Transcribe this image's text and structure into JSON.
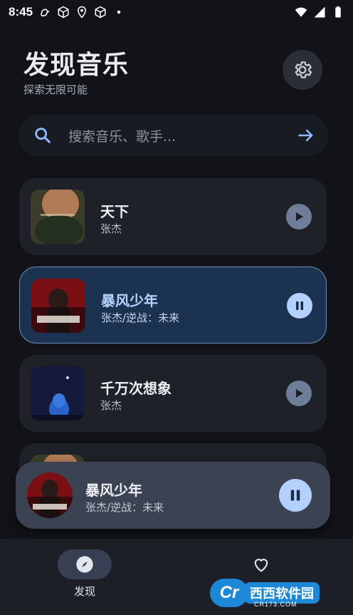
{
  "status_bar": {
    "time": "8:45"
  },
  "header": {
    "title": "发现音乐",
    "subtitle": "探索无限可能"
  },
  "search": {
    "placeholder": "搜索音乐、歌手..."
  },
  "songs": [
    {
      "title": "天下",
      "artist": "张杰",
      "state": "play"
    },
    {
      "title": "暴风少年",
      "artist": "张杰/逆战：未来",
      "state": "pause"
    },
    {
      "title": "千万次想象",
      "artist": "张杰",
      "state": "play"
    }
  ],
  "now_playing": {
    "title": "暴风少年",
    "artist": "张杰/逆战：未来"
  },
  "bottom_nav": {
    "discover_label": "发现"
  },
  "watermark": {
    "badge": "Cr",
    "text": "西西软件园",
    "sub": "CR173.COM"
  },
  "colors": {
    "background": "#111318",
    "card": "#1e2128",
    "active_card": "#1b3350",
    "accent": "#b3d0ff",
    "search_icon": "#8fb9ff"
  }
}
